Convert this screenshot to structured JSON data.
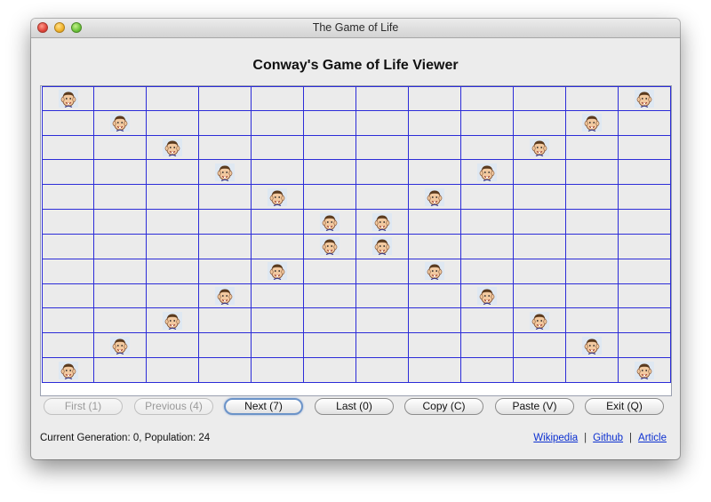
{
  "window": {
    "title": "The Game of Life"
  },
  "heading": "Conway's Game of Life Viewer",
  "grid": {
    "rows": 12,
    "cols": 12,
    "cell_icon": "cartoon-face-icon",
    "line_color": "#2c2cd8",
    "cell_color": "#ebebeb",
    "live_cells": [
      [
        0,
        0
      ],
      [
        0,
        11
      ],
      [
        1,
        1
      ],
      [
        1,
        10
      ],
      [
        2,
        2
      ],
      [
        2,
        9
      ],
      [
        3,
        3
      ],
      [
        3,
        8
      ],
      [
        4,
        4
      ],
      [
        4,
        7
      ],
      [
        5,
        5
      ],
      [
        5,
        6
      ],
      [
        6,
        5
      ],
      [
        6,
        6
      ],
      [
        7,
        4
      ],
      [
        7,
        7
      ],
      [
        8,
        3
      ],
      [
        8,
        8
      ],
      [
        9,
        2
      ],
      [
        9,
        9
      ],
      [
        10,
        1
      ],
      [
        10,
        10
      ],
      [
        11,
        0
      ],
      [
        11,
        11
      ]
    ]
  },
  "buttons": [
    {
      "label": "First (1)",
      "state": "disabled"
    },
    {
      "label": "Previous (4)",
      "state": "disabled"
    },
    {
      "label": "Next (7)",
      "state": "default"
    },
    {
      "label": "Last (0)",
      "state": "enabled"
    },
    {
      "label": "Copy (C)",
      "state": "enabled"
    },
    {
      "label": "Paste (V)",
      "state": "enabled"
    },
    {
      "label": "Exit (Q)",
      "state": "enabled"
    }
  ],
  "status": "Current Generation: 0, Population: 24",
  "links": {
    "wikipedia": "Wikipedia",
    "github": "Github",
    "article": "Article",
    "separator": "|"
  }
}
